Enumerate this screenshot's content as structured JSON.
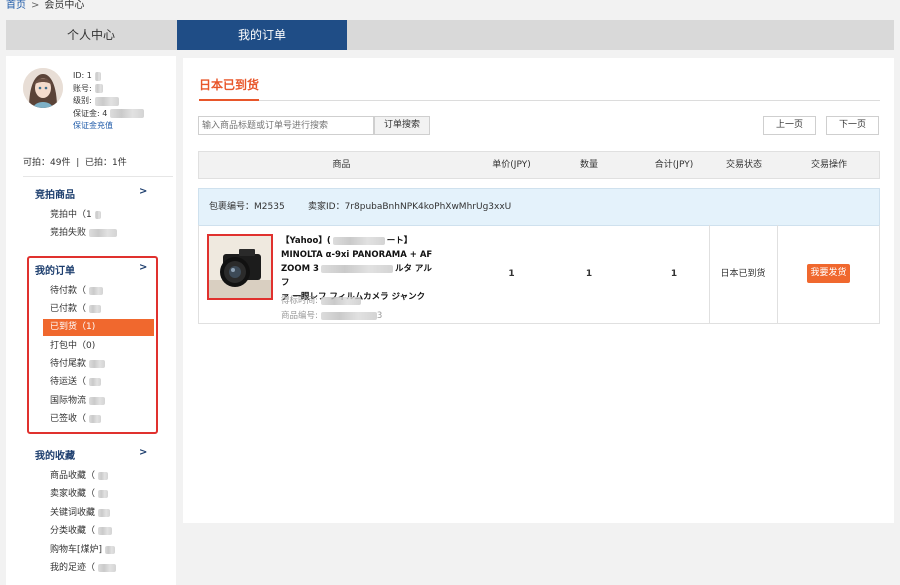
{
  "breadcrumb": {
    "home": "首页",
    "separator": ">",
    "current": "会员中心"
  },
  "topnav": {
    "tabs": [
      {
        "label": "个人中心"
      },
      {
        "label": "我的订单"
      }
    ]
  },
  "profile": {
    "id_label": "ID:",
    "id_value": "1",
    "account_label": "账号:",
    "level_label": "级别:",
    "deposit_label": "保证金:",
    "deposit_value": "4",
    "recharge_link": "保证金充值",
    "can_bid": "可拍：49件",
    "divider": "|",
    "bid": "已拍：1件"
  },
  "sidebar": {
    "groups": [
      {
        "title": "竞拍商品",
        "arrow": ">",
        "items": [
          {
            "label": "竞拍中（",
            "suffix": "1"
          },
          {
            "label": "竞拍失败",
            "suffix": ""
          }
        ]
      },
      {
        "title": "我的订单",
        "arrow": ">",
        "items": [
          {
            "label": "待付款（",
            "suffix": ""
          },
          {
            "label": "已付款（",
            "suffix": ""
          },
          {
            "label": "已到货（",
            "suffix": "1)"
          },
          {
            "label": "打包中（",
            "suffix": "0)"
          },
          {
            "label": "待付尾款",
            "suffix": ""
          },
          {
            "label": "待运送（",
            "suffix": ""
          },
          {
            "label": "国际物流",
            "suffix": ""
          },
          {
            "label": "已签收（",
            "suffix": ""
          }
        ]
      },
      {
        "title": "我的收藏",
        "arrow": ">",
        "items": [
          {
            "label": "商品收藏（",
            "suffix": ""
          },
          {
            "label": "卖家收藏（",
            "suffix": ""
          },
          {
            "label": "关键词收藏",
            "suffix": ""
          },
          {
            "label": "分类收藏（",
            "suffix": ""
          },
          {
            "label": "购物车[煤炉]",
            "suffix": ""
          },
          {
            "label": "我的足迹（",
            "suffix": ""
          }
        ]
      }
    ]
  },
  "main": {
    "title": "日本已到货",
    "search_placeholder": "输入商品标题或订单号进行搜索",
    "search_button": "订单搜索",
    "prev_page": "上一页",
    "next_page": "下一页",
    "columns": {
      "product": "商品",
      "unit_price": "单价(JPY)",
      "quantity": "数量",
      "total": "合计(JPY)",
      "status": "交易状态",
      "action": "交易操作"
    },
    "package": {
      "package_no": "包裹编号：M2535",
      "seller_id": "卖家ID：7r8pubaBnhNPK4koPhXwMhrUg3xxU"
    },
    "order": {
      "name_line1": "【Yahoo】(",
      "name_line1_tail": "ート】",
      "name_line2": "MINOLTA α-9xi PANORAMA + AF",
      "name_line3_a": "ZOOM 3",
      "name_line3_b": "ルタ アルフ",
      "name_line4": "ァ 一眼レフ フィルムカメラ ジャンク",
      "bid_time_label": "得标时间:",
      "product_no_label": "商品编号:",
      "product_no_tail": "3",
      "unit_price": "1",
      "quantity": "1",
      "total": "1",
      "status": "日本已到货",
      "action": "我要发货"
    }
  }
}
